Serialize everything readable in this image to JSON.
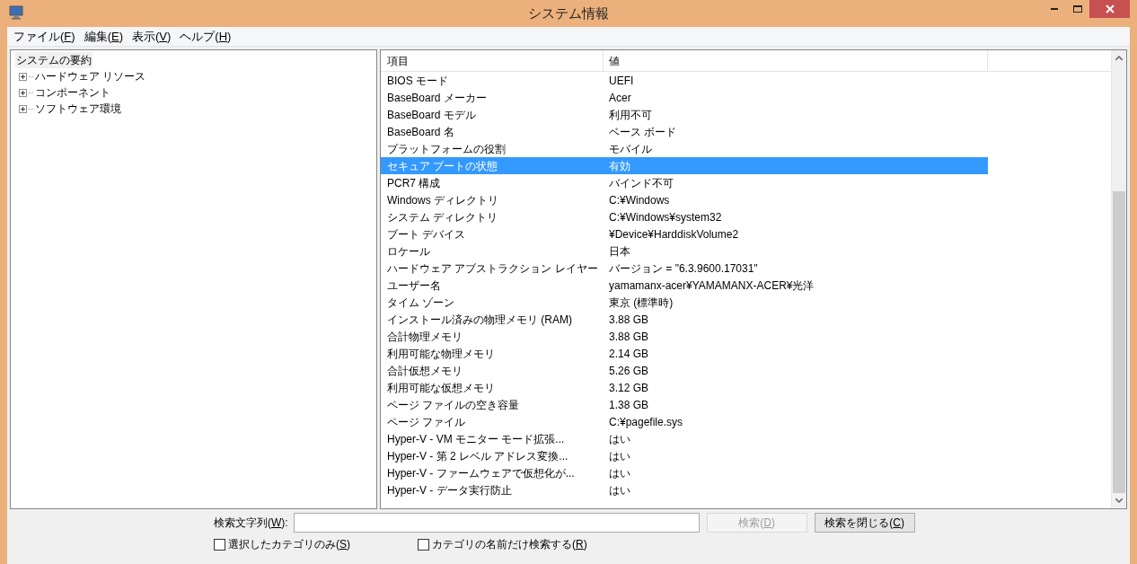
{
  "window": {
    "title": "システム情報"
  },
  "menu": [
    {
      "before": "ファイル(",
      "key": "F",
      "after": ")"
    },
    {
      "before": "編集(",
      "key": "E",
      "after": ")"
    },
    {
      "before": "表示(",
      "key": "V",
      "after": ")"
    },
    {
      "before": "ヘルプ(",
      "key": "H",
      "after": ")"
    }
  ],
  "tree": {
    "root": {
      "label": "システムの要約",
      "selected": true
    },
    "items": [
      {
        "label": "ハードウェア リソース",
        "expanded": false
      },
      {
        "label": "コンポーネント",
        "expanded": false
      },
      {
        "label": "ソフトウェア環境",
        "expanded": false
      }
    ]
  },
  "table": {
    "columns": [
      "項目",
      "値"
    ],
    "rows": [
      {
        "item": "BIOS モード",
        "value": "UEFI",
        "selected": false
      },
      {
        "item": "BaseBoard メーカー",
        "value": "Acer",
        "selected": false
      },
      {
        "item": "BaseBoard モデル",
        "value": "利用不可",
        "selected": false
      },
      {
        "item": "BaseBoard 名",
        "value": "ベース ボード",
        "selected": false
      },
      {
        "item": "プラットフォームの役割",
        "value": "モバイル",
        "selected": false
      },
      {
        "item": "セキュア ブートの状態",
        "value": "有効",
        "selected": true
      },
      {
        "item": "PCR7 構成",
        "value": "バインド不可",
        "selected": false
      },
      {
        "item": "Windows ディレクトリ",
        "value": "C:¥Windows",
        "selected": false
      },
      {
        "item": "システム ディレクトリ",
        "value": "C:¥Windows¥system32",
        "selected": false
      },
      {
        "item": "ブート デバイス",
        "value": "¥Device¥HarddiskVolume2",
        "selected": false
      },
      {
        "item": "ロケール",
        "value": "日本",
        "selected": false
      },
      {
        "item": "ハードウェア アブストラクション レイヤー",
        "value": "バージョン = \"6.3.9600.17031\"",
        "selected": false
      },
      {
        "item": "ユーザー名",
        "value": "yamamanx-acer¥YAMAMANX-ACER¥光洋",
        "selected": false
      },
      {
        "item": "タイム ゾーン",
        "value": "東京 (標準時)",
        "selected": false
      },
      {
        "item": "インストール済みの物理メモリ (RAM)",
        "value": "3.88 GB",
        "selected": false
      },
      {
        "item": "合計物理メモリ",
        "value": "3.88 GB",
        "selected": false
      },
      {
        "item": "利用可能な物理メモリ",
        "value": "2.14 GB",
        "selected": false
      },
      {
        "item": "合計仮想メモリ",
        "value": "5.26 GB",
        "selected": false
      },
      {
        "item": "利用可能な仮想メモリ",
        "value": "3.12 GB",
        "selected": false
      },
      {
        "item": "ページ ファイルの空き容量",
        "value": "1.38 GB",
        "selected": false
      },
      {
        "item": "ページ ファイル",
        "value": "C:¥pagefile.sys",
        "selected": false
      },
      {
        "item": "Hyper-V - VM モニター モード拡張...",
        "value": "はい",
        "selected": false
      },
      {
        "item": "Hyper-V - 第 2 レベル アドレス変換...",
        "value": "はい",
        "selected": false
      },
      {
        "item": "Hyper-V - ファームウェアで仮想化が...",
        "value": "はい",
        "selected": false
      },
      {
        "item": "Hyper-V - データ実行防止",
        "value": "はい",
        "selected": false
      }
    ]
  },
  "search": {
    "label": {
      "before": "検索文字列(",
      "key": "W",
      "after": "):"
    },
    "buttons": [
      {
        "before": "検索(",
        "key": "D",
        "after": ")",
        "disabled": true
      },
      {
        "before": "検索を閉じる(",
        "key": "C",
        "after": ")",
        "disabled": false
      }
    ],
    "options": [
      {
        "before": "選択したカテゴリのみ(",
        "key": "S",
        "after": ")",
        "checked": false
      },
      {
        "before": "カテゴリの名前だけ検索する(",
        "key": "R",
        "after": ")",
        "checked": false
      }
    ]
  }
}
